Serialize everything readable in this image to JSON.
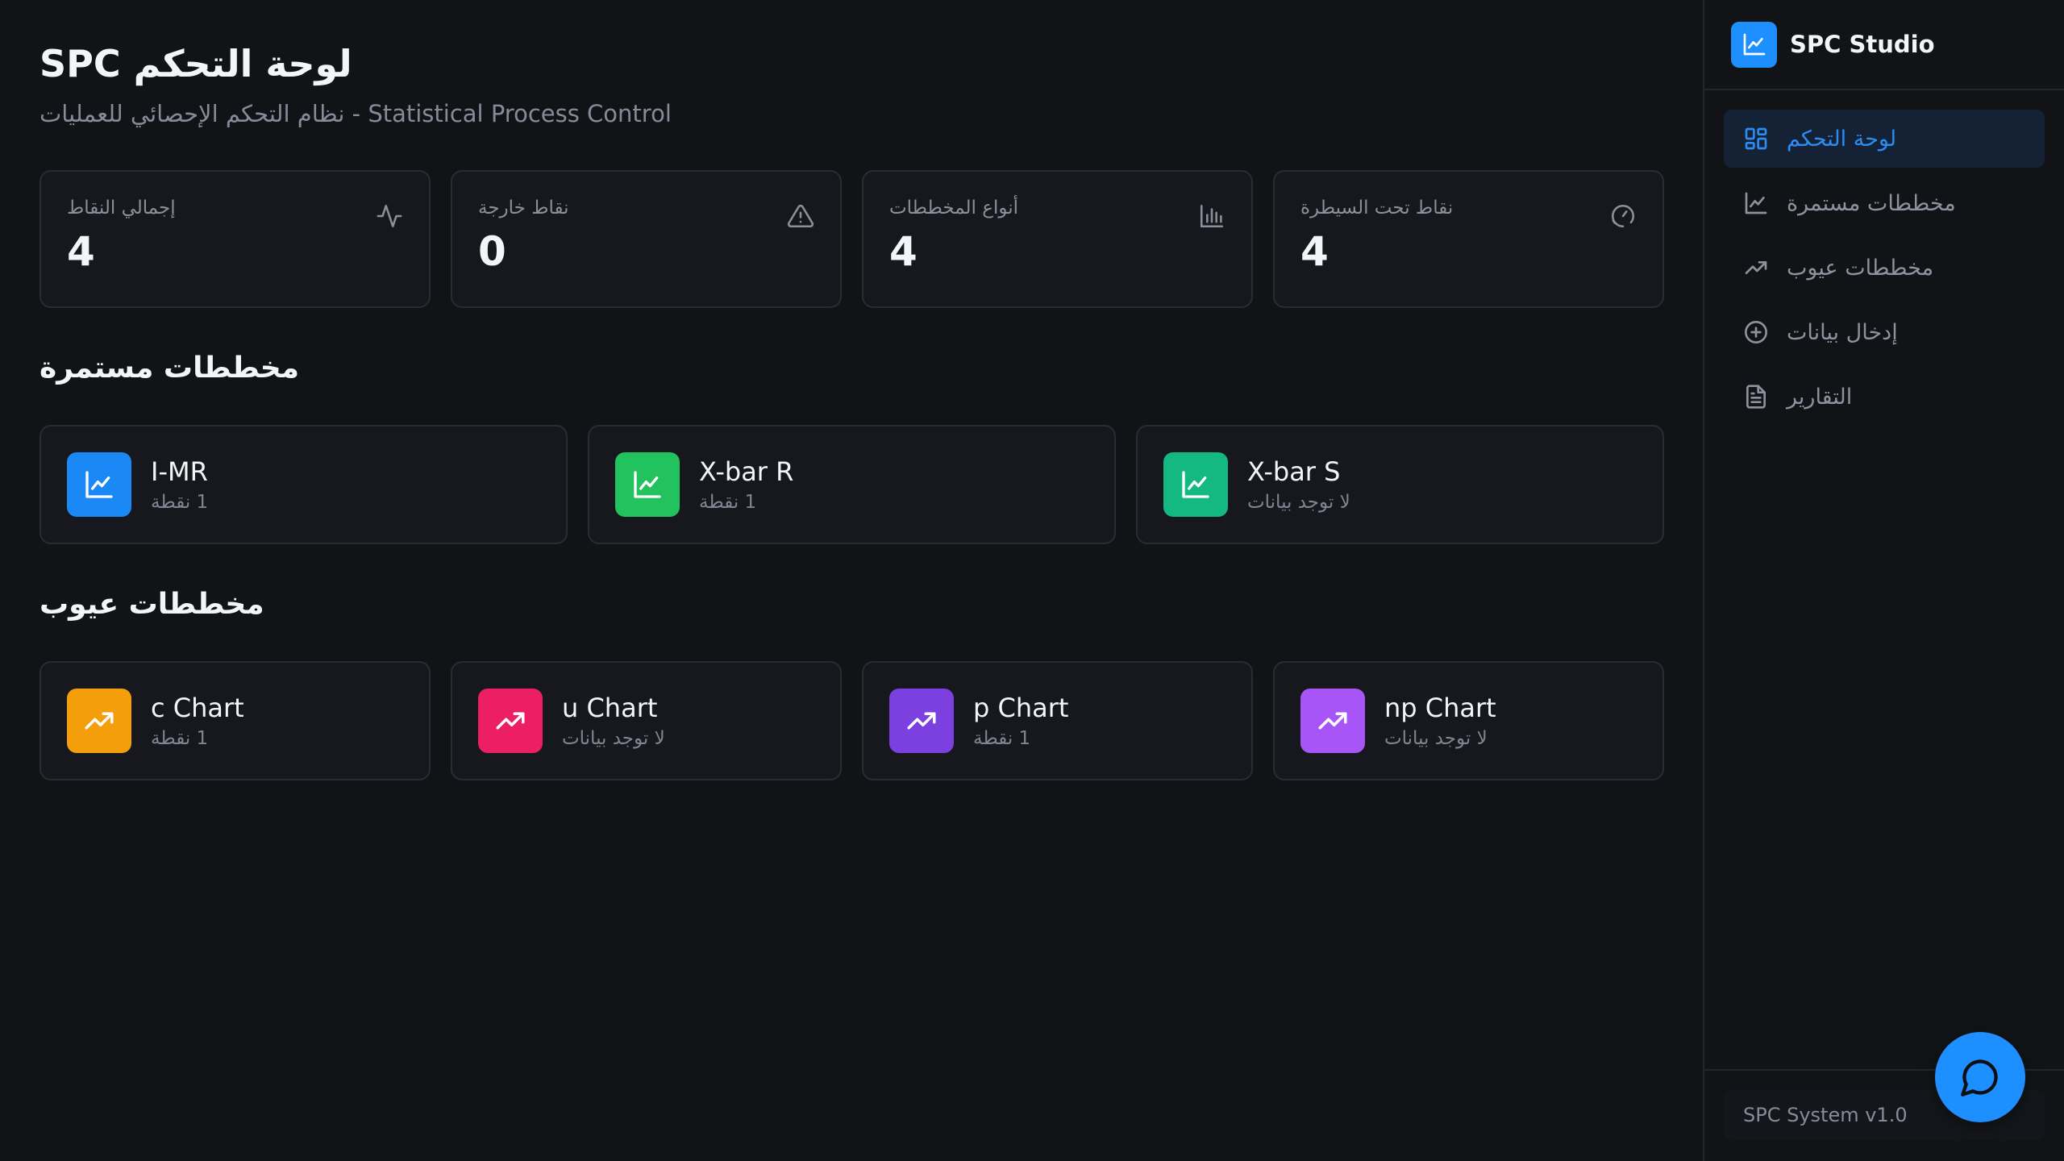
{
  "header": {
    "title": "لوحة التحكم SPC",
    "subtitle": "نظام التحكم الإحصائي للعمليات - Statistical Process Control"
  },
  "stats": [
    {
      "label": "إجمالي النقاط",
      "value": "4",
      "icon": "activity-icon"
    },
    {
      "label": "نقاط خارجة",
      "value": "0",
      "icon": "alert-triangle-icon"
    },
    {
      "label": "أنواع المخططات",
      "value": "4",
      "icon": "bar-chart-icon"
    },
    {
      "label": "نقاط تحت السيطرة",
      "value": "4",
      "icon": "gauge-icon"
    }
  ],
  "continuous": {
    "title": "مخططات مستمرة",
    "cards": [
      {
        "name": "I-MR",
        "sub": "1 نقطة",
        "color": "#1a88f5",
        "icon": "line-chart-icon"
      },
      {
        "name": "X-bar R",
        "sub": "1 نقطة",
        "color": "#22c35e",
        "icon": "line-chart-icon"
      },
      {
        "name": "X-bar S",
        "sub": "لا توجد بيانات",
        "color": "#13b981",
        "icon": "line-chart-icon"
      }
    ]
  },
  "defects": {
    "title": "مخططات عيوب",
    "cards": [
      {
        "name": "c Chart",
        "sub": "1 نقطة",
        "color": "#f59e0c",
        "icon": "trending-up-icon"
      },
      {
        "name": "u Chart",
        "sub": "لا توجد بيانات",
        "color": "#ec1f65",
        "icon": "trending-up-icon"
      },
      {
        "name": "p Chart",
        "sub": "1 نقطة",
        "color": "#7c3fe0",
        "icon": "trending-up-icon"
      },
      {
        "name": "np Chart",
        "sub": "لا توجد بيانات",
        "color": "#a855f7",
        "icon": "trending-up-icon"
      }
    ]
  },
  "sidebar": {
    "brand": "SPC Studio",
    "items": [
      {
        "label": "لوحة التحكم",
        "icon": "dashboard-icon",
        "active": true
      },
      {
        "label": "مخططات مستمرة",
        "icon": "line-chart-icon",
        "active": false
      },
      {
        "label": "مخططات عيوب",
        "icon": "trending-up-icon",
        "active": false
      },
      {
        "label": "إدخال بيانات",
        "icon": "plus-circle-icon",
        "active": false
      },
      {
        "label": "التقارير",
        "icon": "file-text-icon",
        "active": false
      }
    ],
    "version": "SPC System v1.0"
  },
  "colors": {
    "accent": "#1d8fff",
    "background": "#121317",
    "card": "#17181d"
  }
}
